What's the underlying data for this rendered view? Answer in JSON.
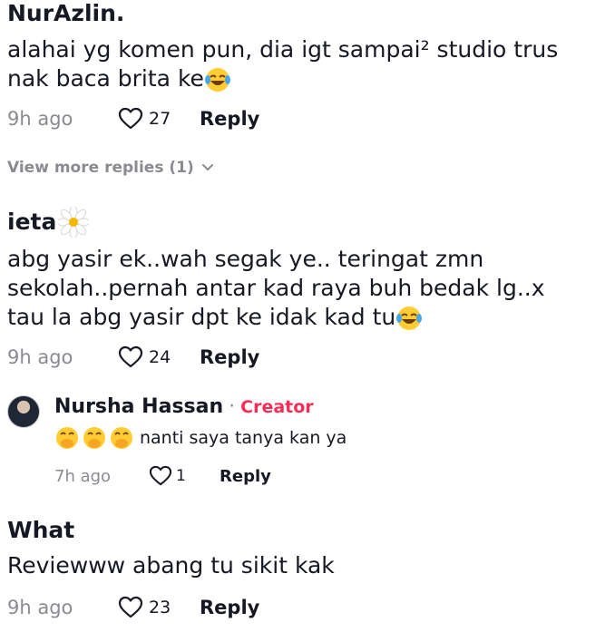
{
  "comments": [
    {
      "username": "NurAzlin.",
      "lines": [
        "alahai yg komen pun, dia igt sampai² studio trus",
        "nak baca brita ke"
      ],
      "time": "9h ago",
      "likes": "27",
      "reply_label": "Reply"
    },
    {
      "username": "ieta",
      "lines": [
        "abg yasir ek..wah segak ye.. teringat zmn",
        "sekolah..pernah antar kad raya buh bedak lg..x",
        "tau la abg yasir dpt ke idak kad tu"
      ],
      "time": "9h ago",
      "likes": "24",
      "reply_label": "Reply"
    },
    {
      "username": "What",
      "lines": [
        "Reviewww abang tu sikit kak"
      ],
      "time": "9h ago",
      "likes": "23",
      "reply_label": "Reply"
    }
  ],
  "view_more": {
    "label": "View more replies (1)"
  },
  "reply": {
    "username": "Nursha Hassan",
    "separator": "·",
    "badge": "Creator",
    "text": "nanti saya tanya kan ya",
    "time": "7h ago",
    "likes": "1",
    "reply_label": "Reply"
  },
  "colors": {
    "text": "#161823",
    "muted": "#8a8b91",
    "creator": "#fe2c55"
  },
  "icons": {
    "like": "heart-outline-icon",
    "expand": "chevron-down-icon",
    "laugh": "tears-of-joy-emoji",
    "flower": "daisy-emoji",
    "shy": "hand-over-mouth-emoji"
  }
}
